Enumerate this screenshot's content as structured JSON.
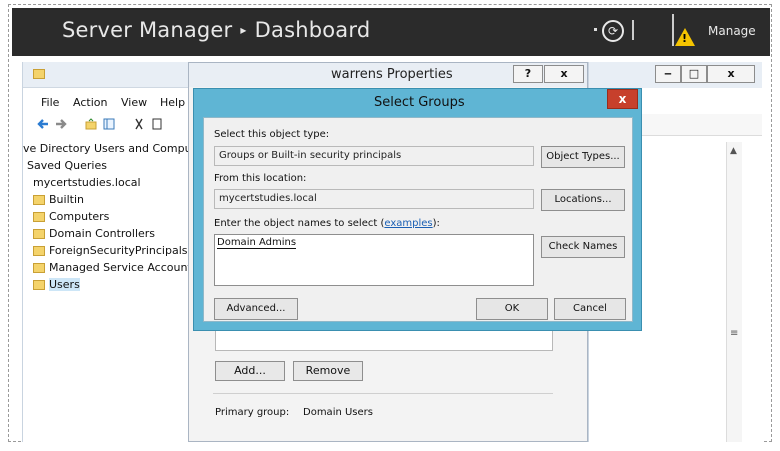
{
  "server_manager": {
    "title": "Server Manager",
    "crumb": "Dashboard",
    "separator_glyph": "▸",
    "manage_label": "Manage"
  },
  "aduc": {
    "menu": [
      "File",
      "Action",
      "View",
      "Help"
    ],
    "tree": [
      {
        "label": "ve Directory Users and Comput"
      },
      {
        "label": "Saved Queries"
      },
      {
        "label": "mycertstudies.local"
      },
      {
        "label": "Builtin"
      },
      {
        "label": "Computers"
      },
      {
        "label": "Domain Controllers"
      },
      {
        "label": "ForeignSecurityPrincipals"
      },
      {
        "label": "Managed Service Accounts"
      },
      {
        "label": "Users"
      }
    ]
  },
  "properties": {
    "title": "warrens Properties",
    "help_button": "?",
    "close_button": "x",
    "add_button": "Add...",
    "remove_button": "Remove",
    "primary_group_label": "Primary group:",
    "primary_group_value": "Domain Users"
  },
  "right_window": {
    "minimize": "‒",
    "maximize": "□",
    "close": "x"
  },
  "select_groups": {
    "title": "Select Groups",
    "close_button": "x",
    "object_type_label": "Select this object type:",
    "object_type_value": "Groups or Built-in security principals",
    "object_types_button": "Object Types...",
    "location_label": "From this location:",
    "location_value": "mycertstudies.local",
    "locations_button": "Locations...",
    "names_label_prefix": "Enter the object names to select (",
    "names_label_link": "examples",
    "names_label_suffix": "):",
    "names_value": "Domain Admins",
    "check_names_button": "Check Names",
    "advanced_button": "Advanced...",
    "ok_button": "OK",
    "cancel_button": "Cancel"
  },
  "colors": {
    "dialog_frame": "#5fb5d4",
    "close_red": "#c7402c",
    "titlebar_dark": "#2b2b2b",
    "link_blue": "#1a5fb4"
  }
}
